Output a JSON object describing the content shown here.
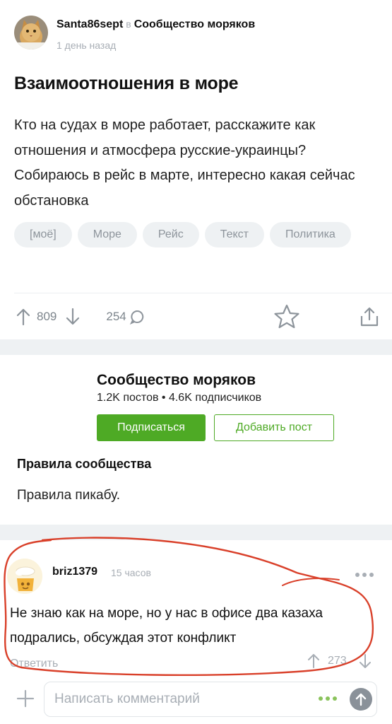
{
  "post": {
    "author": "Santa86sept",
    "in_word": "в",
    "community": "Сообщество моряков",
    "time": "1 день назад",
    "title": "Взаимоотношения в море",
    "body": "Кто на судах в море работает, расскажите как отношения и атмосфера русские-украинцы? Собираюсь в рейс в марте, интересно какая сейчас обстановка",
    "tags": [
      "[моё]",
      "Море",
      "Рейс",
      "Текст",
      "Политика"
    ],
    "rating": "809",
    "comments_count": "254"
  },
  "community_card": {
    "name": "Сообщество моряков",
    "stats": "1.2K постов • 4.6K подписчиков",
    "subscribe_label": "Подписаться",
    "add_post_label": "Добавить пост",
    "rules_title": "Правила сообщества",
    "rules_text": "Правила пикабу."
  },
  "comment": {
    "author": "briz1379",
    "time": "15 часов",
    "text": "Не знаю как на море, но у нас в офисе два казаха подрались, обсуждая этот конфликт",
    "reply_label": "Ответить",
    "rating": "273"
  },
  "composer": {
    "placeholder": "Написать комментарий"
  },
  "colors": {
    "accent_green": "#4eaa25",
    "muted_gray": "#a8aeb5",
    "annotation_red": "#d9402a"
  },
  "icons": [
    "upvote-icon",
    "downvote-icon",
    "comment-bubble-icon",
    "star-icon",
    "share-icon",
    "more-dots-icon",
    "plus-icon",
    "send-arrow-icon"
  ]
}
